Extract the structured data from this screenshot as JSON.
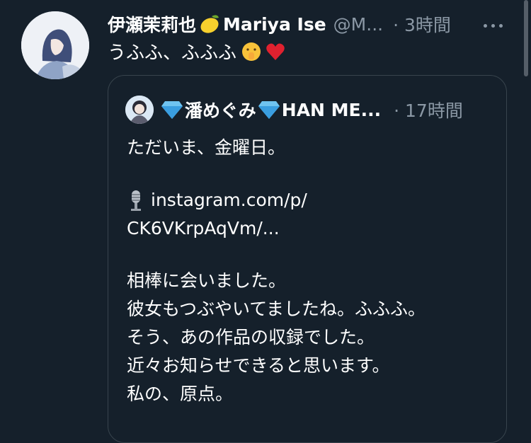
{
  "tweet": {
    "display_name": "伊瀬茉莉也",
    "display_name_suffix": "Mariya Ise",
    "handle": "@M...",
    "time": "· 3時間",
    "text": "うふふ、ふふふ",
    "icons": [
      "lemon-icon",
      "shushing-face-icon",
      "red-heart-icon",
      "more-icon"
    ]
  },
  "quote": {
    "name": "潘めぐみ",
    "name_suffix": "HAN ME...",
    "time": "· 17時間",
    "lines": [
      "ただいま、金曜日。",
      "",
      "instagram.com/p/",
      "CK6VKrpAqVm/...",
      "",
      "相棒に会いました。",
      "彼女もつぶやいてましたね。ふふふ。",
      "そう、あの作品の収録でした。",
      "近々お知らせできると思います。",
      "私の、原点。"
    ],
    "icons": [
      "gem-icon",
      "microphone-icon"
    ]
  },
  "colors": {
    "background": "#15202b",
    "secondary_text": "#8b98a5",
    "border": "#38444d"
  }
}
